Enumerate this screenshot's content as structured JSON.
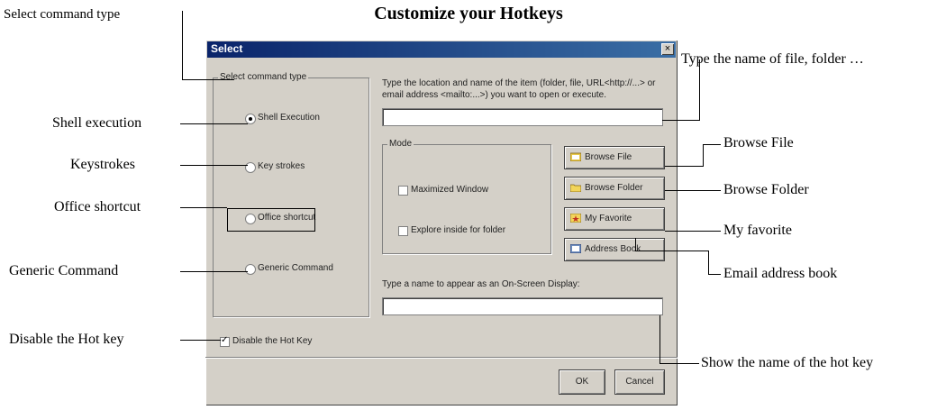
{
  "page_title": "Customize your Hotkeys",
  "annotations": {
    "select_command_type": "Select command type",
    "shell_execution": "Shell execution",
    "keystrokes": "Keystrokes",
    "office_shortcut": "Office shortcut",
    "generic_command": "Generic Command",
    "disable_hot_key": "Disable the Hot key",
    "type_name": "Type the name of file, folder …",
    "browse_file": "Browse File",
    "browse_folder": "Browse Folder",
    "my_favorite": "My favorite",
    "email_address_book": "Email address book",
    "show_name": "Show the name of the hot key"
  },
  "dialog": {
    "title": "Select",
    "close_symbol": "×",
    "command_group_label": "Select command type",
    "options": [
      {
        "label": "Shell Execution",
        "selected": true
      },
      {
        "label": "Key strokes",
        "selected": false
      },
      {
        "label": "Office shortcut",
        "selected": false
      },
      {
        "label": "Generic Command",
        "selected": false
      }
    ],
    "instruction_line1": "Type the location and name of the item (folder, file, URL<http://...> or",
    "instruction_line2": "email address <mailto:...>) you want to open or execute.",
    "location_value": "",
    "mode_label": "Mode",
    "maximized_window": {
      "label": "Maximized Window",
      "checked": false
    },
    "explore_inside": {
      "label": "Explore inside for folder",
      "checked": false
    },
    "buttons": {
      "browse_file": "Browse File",
      "browse_folder": "Browse Folder",
      "my_favorite": "My Favorite",
      "address_book": "Address Book",
      "ok": "OK",
      "cancel": "Cancel"
    },
    "osd_label": "Type a name to appear as an On-Screen Display:",
    "osd_value": "",
    "disable_hotkey": {
      "label": "Disable the Hot Key",
      "checked": true
    }
  }
}
